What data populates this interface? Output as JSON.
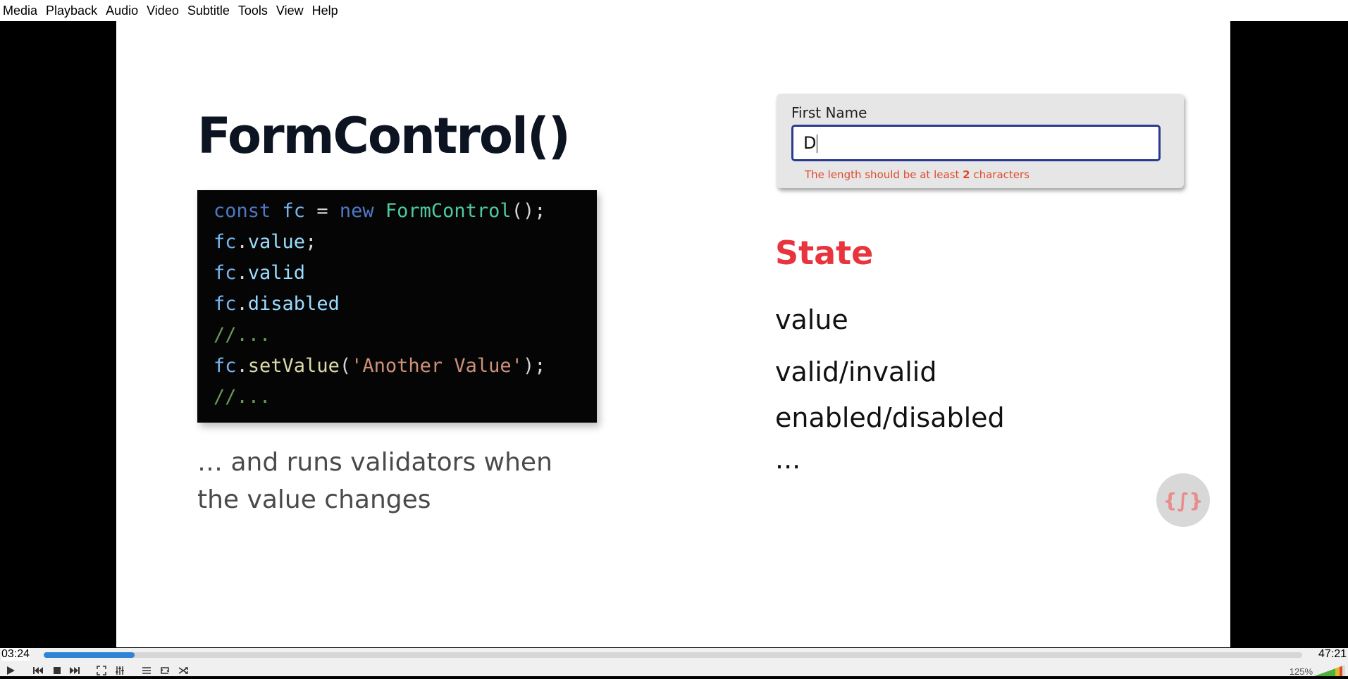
{
  "menu": {
    "items": [
      "Media",
      "Playback",
      "Audio",
      "Video",
      "Subtitle",
      "Tools",
      "View",
      "Help"
    ]
  },
  "slide": {
    "title": "FormControl()",
    "code_lines": [
      [
        {
          "t": "const ",
          "c": "kw"
        },
        {
          "t": "fc",
          "c": "var"
        },
        {
          "t": " = ",
          "c": "plain"
        },
        {
          "t": "new ",
          "c": "kw"
        },
        {
          "t": "FormControl",
          "c": "class"
        },
        {
          "t": "();",
          "c": "plain"
        }
      ],
      [
        {
          "t": "fc",
          "c": "var"
        },
        {
          "t": ".",
          "c": "plain"
        },
        {
          "t": "value",
          "c": "prop"
        },
        {
          "t": ";",
          "c": "plain"
        }
      ],
      [
        {
          "t": "fc",
          "c": "var"
        },
        {
          "t": ".",
          "c": "plain"
        },
        {
          "t": "valid",
          "c": "prop"
        }
      ],
      [
        {
          "t": "fc",
          "c": "var"
        },
        {
          "t": ".",
          "c": "plain"
        },
        {
          "t": "disabled",
          "c": "prop"
        }
      ],
      [
        {
          "t": "//...",
          "c": "comment"
        }
      ],
      [
        {
          "t": "fc",
          "c": "var"
        },
        {
          "t": ".",
          "c": "plain"
        },
        {
          "t": "setValue",
          "c": "fn"
        },
        {
          "t": "(",
          "c": "plain"
        },
        {
          "t": "'Another Value'",
          "c": "str"
        },
        {
          "t": ");",
          "c": "plain"
        }
      ],
      [
        {
          "t": "//...",
          "c": "comment"
        }
      ]
    ],
    "caption_line1": "… and runs validators when",
    "caption_line2": "the value changes",
    "form": {
      "label": "First Name",
      "value": "D",
      "error_prefix": "The length should be at least ",
      "error_bold": "2",
      "error_suffix": " characters"
    },
    "state_heading": "State",
    "state_items": [
      "value",
      "valid/invalid",
      "enabled/disabled",
      "..."
    ],
    "logo_text": "{∫}"
  },
  "player": {
    "elapsed": "03:24",
    "total": "47:21",
    "progress_fraction": 0.072,
    "volume": "125%"
  },
  "colors": {
    "accent": "#e8343c",
    "seek": "#2f84d6",
    "input_border": "#2a3b8f",
    "error": "#e04a2c"
  }
}
